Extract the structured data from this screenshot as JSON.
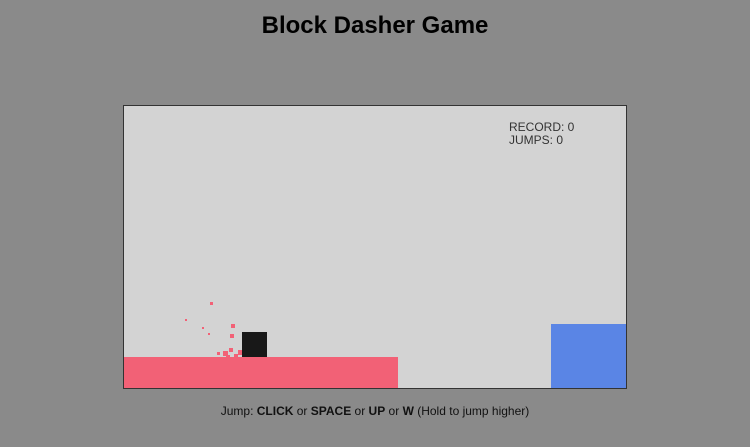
{
  "title": "Block Dasher Game",
  "hud": {
    "record_label": "RECORD: 0",
    "jumps_label": "JUMPS: 0"
  },
  "instructions": {
    "prefix": "Jump: ",
    "key1": "CLICK",
    "sep1": " or ",
    "key2": "SPACE",
    "sep2": " or ",
    "key3": "UP",
    "sep3": " or ",
    "key4": "W",
    "suffix": " (Hold to jump higher)"
  },
  "colors": {
    "background": "#8a8a8a",
    "game_area": "#d3d3d3",
    "platform": "#f26176",
    "goal_block": "#5a85e5",
    "player": "#181818",
    "particles": "#f26176"
  }
}
